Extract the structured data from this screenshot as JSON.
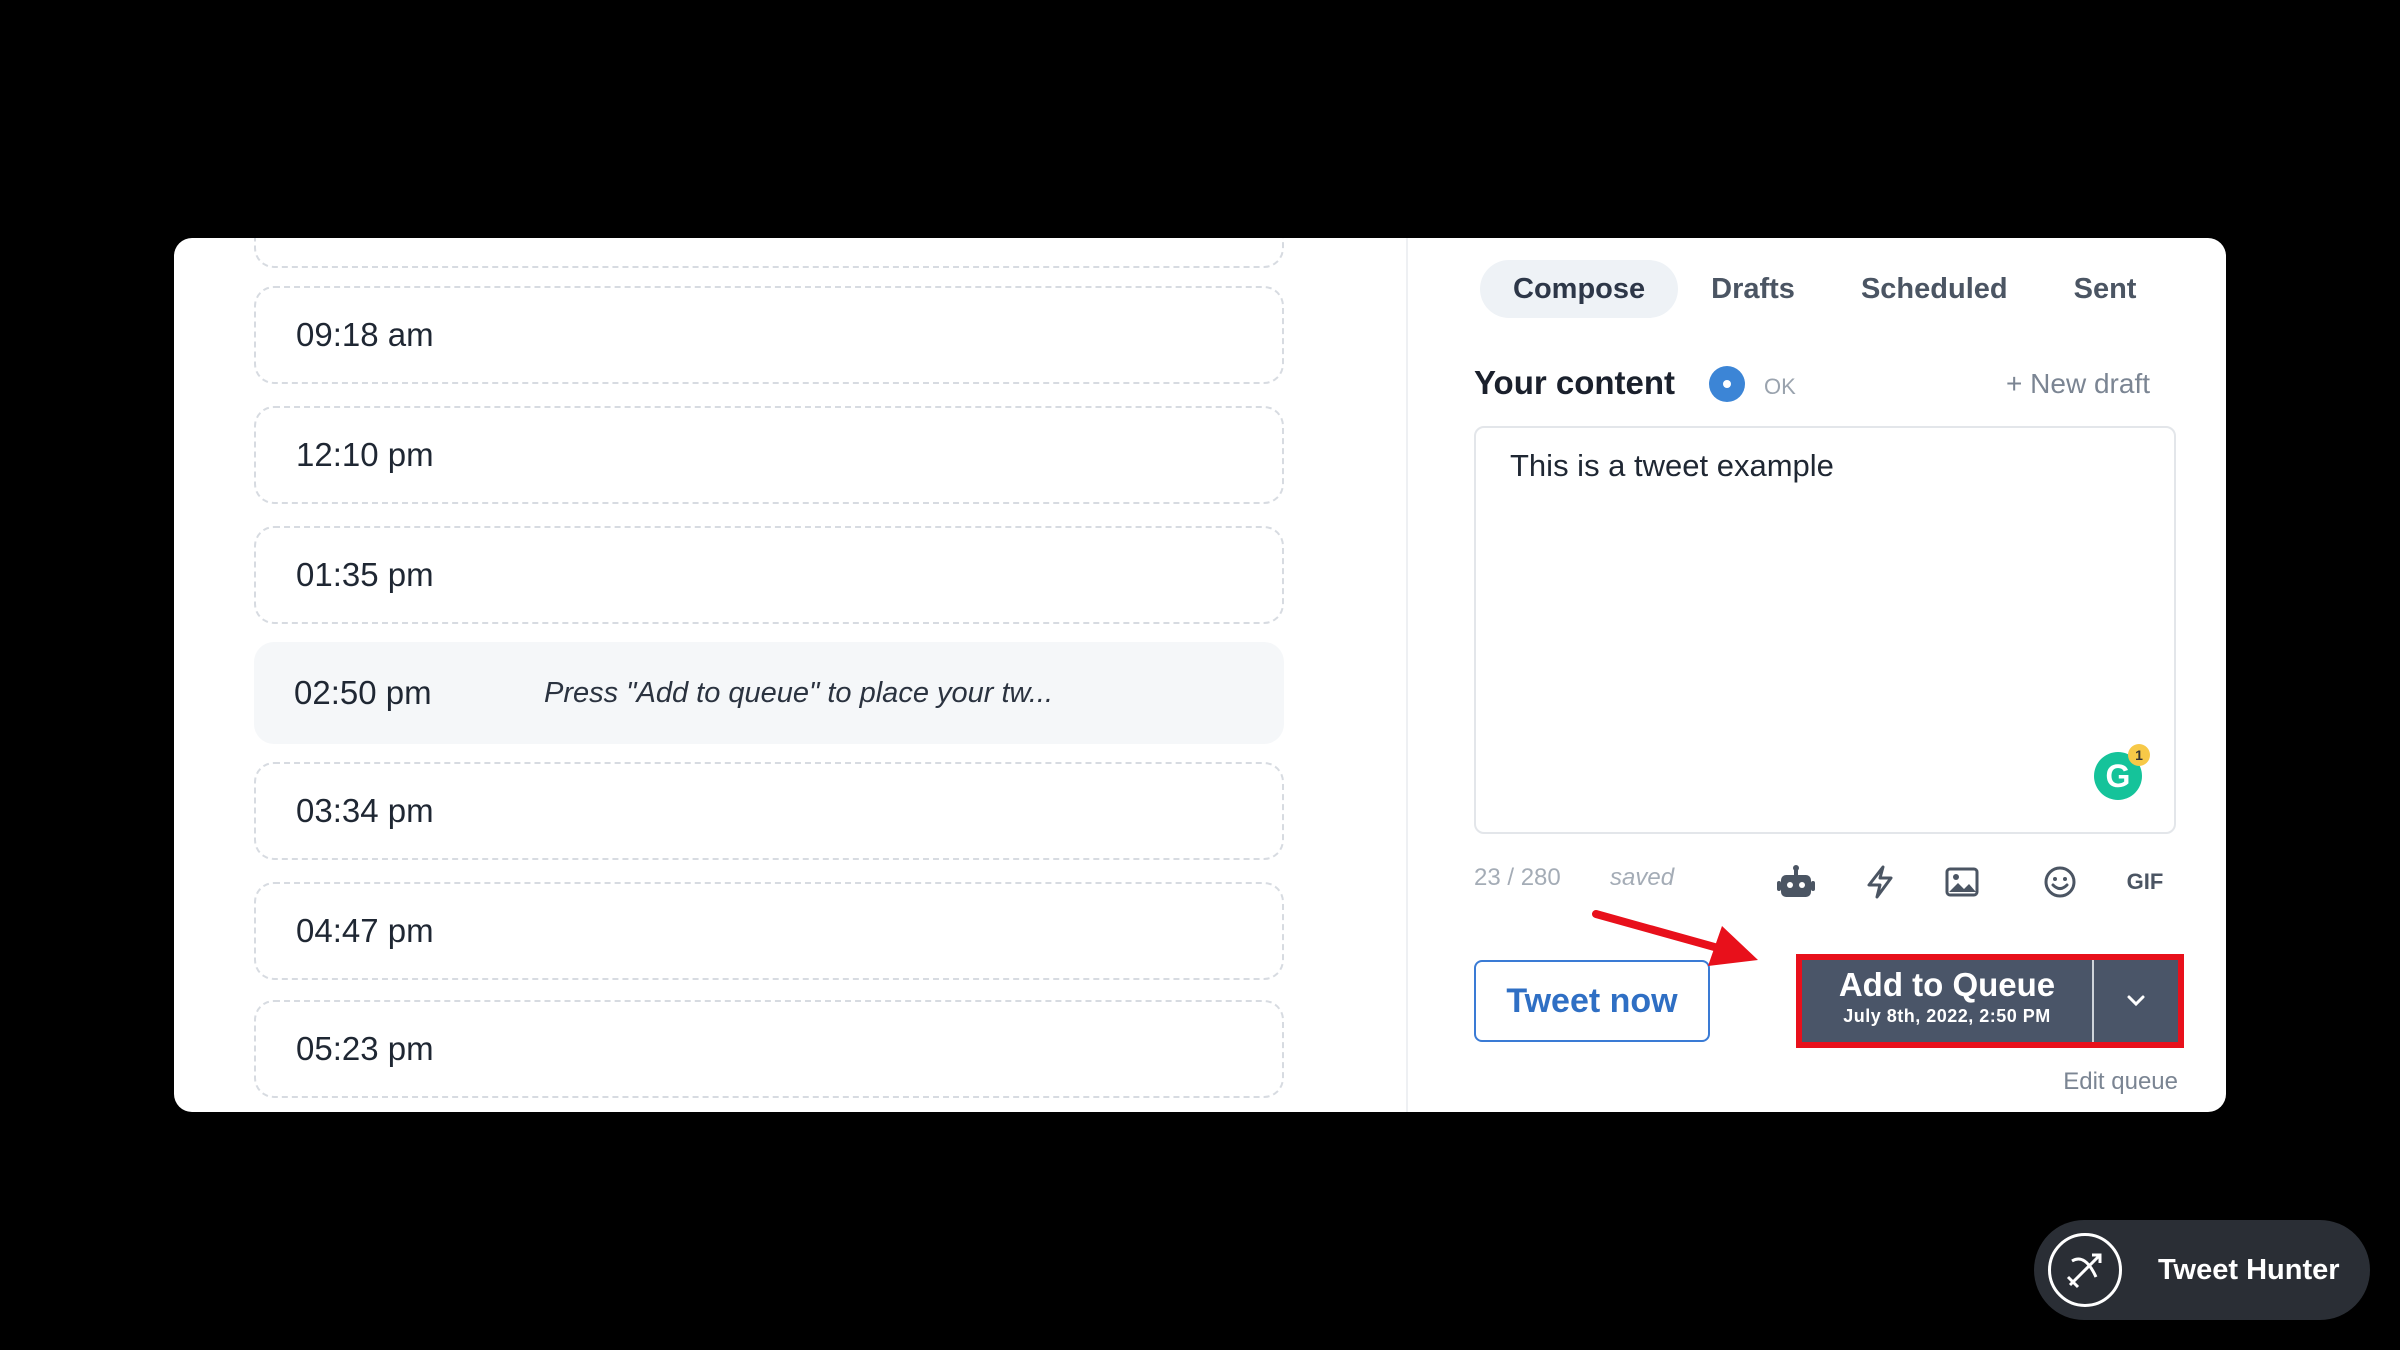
{
  "schedule": {
    "slots": [
      {
        "time": "09:18 am"
      },
      {
        "time": "12:10 pm"
      },
      {
        "time": "01:35 pm"
      },
      {
        "time": "02:50 pm",
        "hint": "Press \"Add to queue\" to place your tw..."
      },
      {
        "time": "03:34 pm"
      },
      {
        "time": "04:47 pm"
      },
      {
        "time": "05:23 pm"
      }
    ]
  },
  "tabs": [
    "Compose",
    "Drafts",
    "Scheduled",
    "Sent"
  ],
  "composer": {
    "label": "Your content",
    "status": "OK",
    "new_draft": "+ New draft",
    "text": "This is a tweet example",
    "grammarly_count": "1",
    "counter": "23 / 280",
    "saved": "saved",
    "gif_label": "GIF"
  },
  "actions": {
    "tweet_now": "Tweet now",
    "add_to_queue": "Add to Queue",
    "queue_time": "July 8th, 2022, 2:50 PM",
    "edit_queue": "Edit queue"
  },
  "brand": {
    "name": "Tweet Hunter"
  },
  "colors": {
    "accent": "#3a7bd5",
    "highlight": "#e8101b",
    "queue_button": "#4a5568"
  }
}
